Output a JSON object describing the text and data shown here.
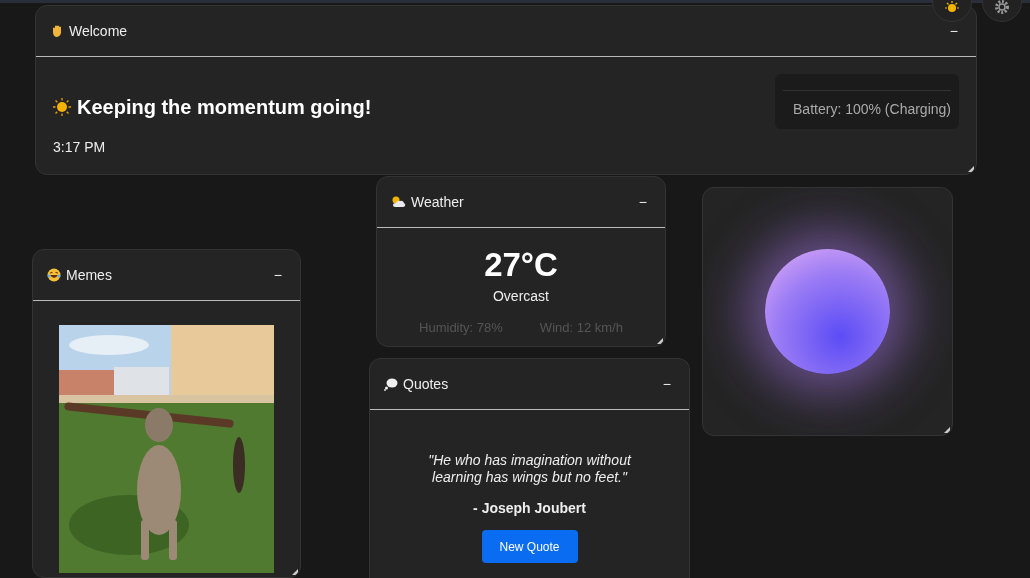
{
  "widgets": [
    {
      "kind": "welcome",
      "title": "Welcome",
      "minimize": "−",
      "greeting": "Keeping the momentum going!",
      "time": "3:17 PM",
      "battery": "Battery: 100% (Charging)"
    },
    {
      "kind": "weather",
      "title": "Weather",
      "minimize": "−",
      "temperature": "27°C",
      "condition": "Overcast",
      "humidity": "Humidity: 78%",
      "wind": "Wind: 12 km/h"
    },
    {
      "kind": "memes",
      "title": "Memes",
      "minimize": "−"
    },
    {
      "kind": "quotes",
      "title": "Quotes",
      "minimize": "−",
      "quote": "\"He who has imagination without learning has wings but no feet.\"",
      "author": "- Joseph Joubert",
      "button": "New Quote"
    },
    {
      "kind": "orb"
    }
  ]
}
